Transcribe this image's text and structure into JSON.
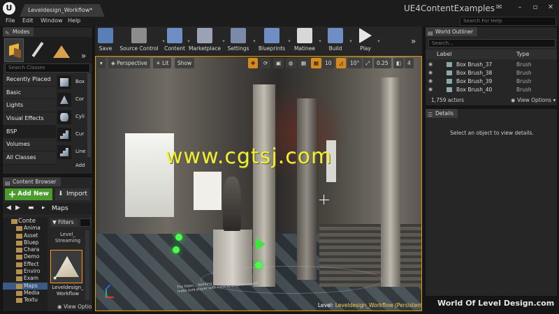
{
  "window": {
    "doc_tab": "Leveldesign_Workflow*",
    "project": "UE4ContentExamples",
    "logo": "U",
    "search_help_placeholder": "Search For Help"
  },
  "menu": [
    "File",
    "Edit",
    "Window",
    "Help"
  ],
  "modes": {
    "tab_label": "Modes",
    "search_placeholder": "Search Classes",
    "categories": [
      "Recently Placed",
      "Basic",
      "Lights",
      "Visual Effects",
      "BSP",
      "Volumes",
      "All Classes"
    ],
    "active_category": "BSP",
    "classes": [
      "Box",
      "Cor",
      "Cyli",
      "Cur",
      "Line",
      "Add"
    ]
  },
  "content_browser": {
    "tab_label": "Content Browser",
    "add_new": "Add New",
    "import": "Import",
    "breadcrumb": "Maps",
    "filters": "Filters",
    "tree": [
      "Conte",
      "Anima",
      "Asset",
      "Bluep",
      "Chara",
      "Demo",
      "Effect",
      "Enviro",
      "Exam",
      "Maps",
      "Media",
      "Textu"
    ],
    "selected_folder": "Maps",
    "asset_above": "Level_\nStreaming",
    "asset_name": "Leveldesign_\nWorkflow",
    "view_options": "View Optio"
  },
  "toolbar": [
    {
      "label": "Save",
      "icon": "save-icon",
      "color": "#5a7fb8"
    },
    {
      "label": "Source Control",
      "icon": "source-control-icon",
      "color": "#8c8c8c"
    },
    {
      "label": "Content",
      "icon": "content-icon",
      "color": "#6f8fc4"
    },
    {
      "label": "Marketplace",
      "icon": "marketplace-icon",
      "color": "#9aa3b5"
    },
    {
      "label": "Settings",
      "icon": "settings-gear-icon",
      "color": "#7a8aa8"
    },
    {
      "label": "Blueprints",
      "icon": "blueprints-icon",
      "color": "#6f8fc4"
    },
    {
      "label": "Matinee",
      "icon": "matinee-icon",
      "color": "#d8d8d8"
    },
    {
      "label": "Build",
      "icon": "build-icon",
      "color": "#6f8fc4"
    },
    {
      "label": "Play",
      "icon": "play-icon",
      "color": "#e6e6e6"
    }
  ],
  "viewport": {
    "perspective": "Perspective",
    "lit": "Lit",
    "show": "Show",
    "grid_snap": "10",
    "rot_snap": "10°",
    "scale_snap": "0.25",
    "cam_speed": "4",
    "watermark": "www.cgtsj.com",
    "level_prefix": "Level:",
    "level_name": "Leveldesign_Workflow (Persistent)",
    "caption": "The Pawn... Working\nmake sure player with class to enabled visuals"
  },
  "outliner": {
    "tab_label": "World Outliner",
    "search_placeholder": "Search...",
    "col_label": "Label",
    "col_type": "Type",
    "rows": [
      {
        "label": "Box Brush_37",
        "type": "Brush"
      },
      {
        "label": "Box Brush_38",
        "type": "Brush"
      },
      {
        "label": "Box Brush_39",
        "type": "Brush"
      },
      {
        "label": "Box Brush_40",
        "type": "Brush"
      }
    ],
    "actor_count": "1,759 actors",
    "view_options": "View Options"
  },
  "details": {
    "tab_label": "Details",
    "message": "Select an object to view details."
  },
  "footer_watermark": "World Of Level Design.com"
}
